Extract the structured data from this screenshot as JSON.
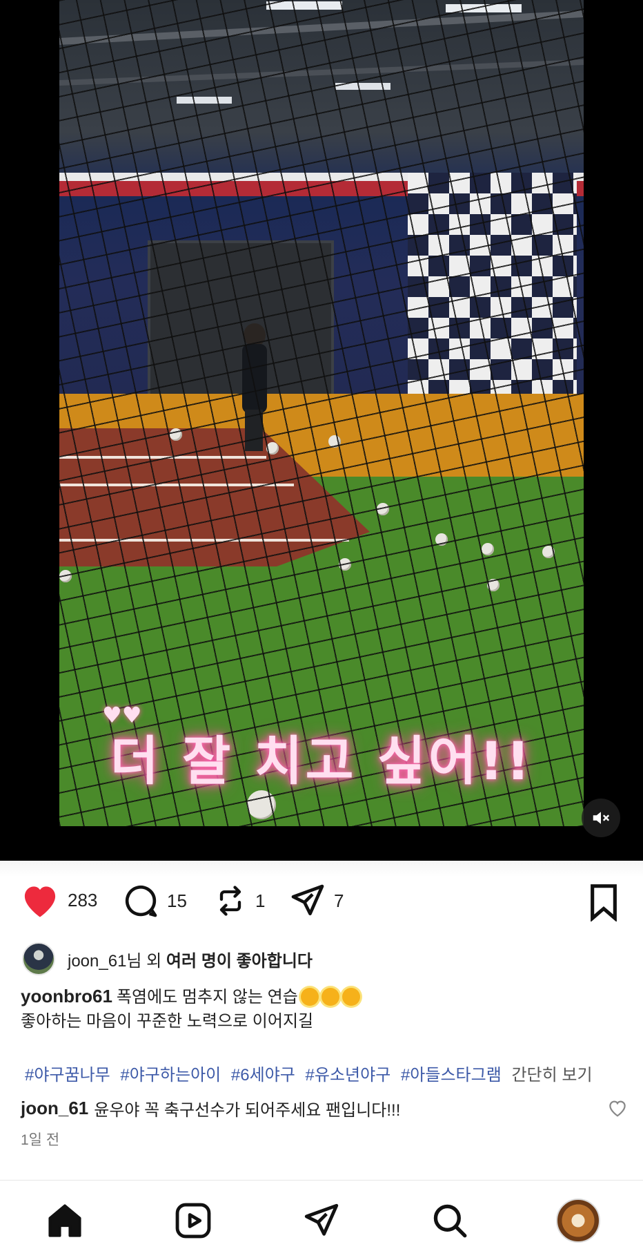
{
  "video": {
    "overlay_caption": "더 잘 치고 싶어!!",
    "overlay_decoration": "♥♥",
    "mute_icon": "speaker-muted-icon"
  },
  "actions": {
    "like_count": "283",
    "comment_count": "15",
    "repost_count": "1",
    "share_count": "7",
    "like_color": "#ed2a3d"
  },
  "likes": {
    "user": "joon_61",
    "suffix": "님 외 ",
    "rest": "여러 명이 좋아합니다"
  },
  "post": {
    "author": "yoonbro61",
    "caption_line1": "폭염에도 멈추지 않는 연습",
    "caption_line2": "좋아하는 마음이 꾸준한 노력으로 이어지길",
    "hashtags": [
      "#야구꿈나무",
      "#야구하는아이",
      "#6세야구",
      "#유소년야구",
      "#아들스타그램"
    ],
    "more_label": "간단히 보기"
  },
  "comment": {
    "user": "joon_61",
    "text": "윤우야 꼭 축구선수가 되어주세요 팬입니다!!!"
  },
  "timestamp": "1일 전",
  "nav": {
    "items": [
      "home-icon",
      "reels-icon",
      "direct-icon",
      "search-icon",
      "profile-avatar"
    ]
  }
}
